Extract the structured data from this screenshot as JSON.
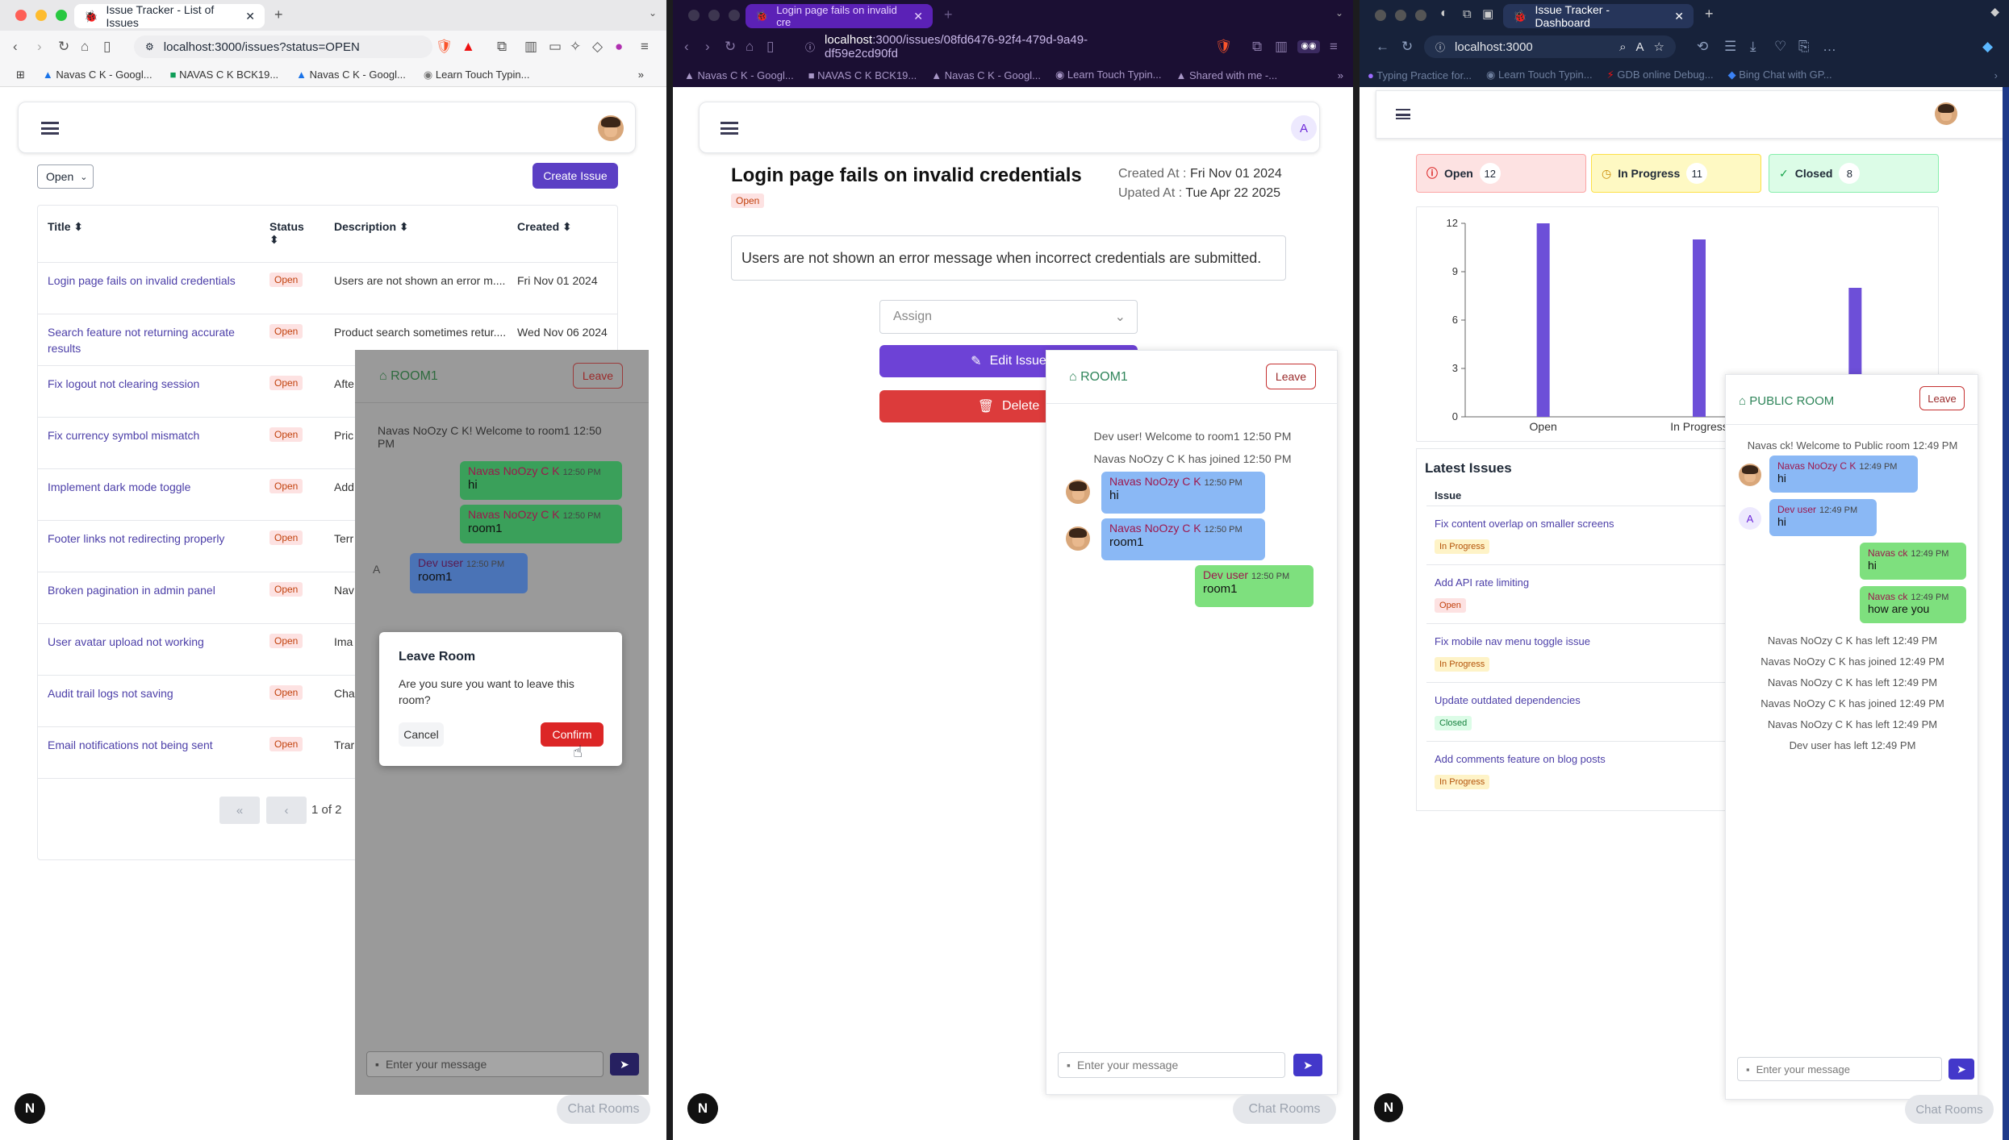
{
  "w1": {
    "tab_title": "Issue Tracker - List of Issues",
    "url": "localhost:3000/issues?status=OPEN",
    "bookmarks": [
      "Navas C K - Googl...",
      "NAVAS C K BCK19...",
      "Navas C K - Googl...",
      "Learn Touch Typin..."
    ],
    "filter": "Open",
    "create_btn": "Create Issue",
    "headers": [
      "Title",
      "Status",
      "Description",
      "Created"
    ],
    "rows": [
      {
        "title": "Login page fails on invalid credentials",
        "status": "Open",
        "desc": "Users are not shown an error m....",
        "created": "Fri Nov 01 2024"
      },
      {
        "title": "Search feature not returning accurate results",
        "status": "Open",
        "desc": "Product search sometimes retur....",
        "created": "Wed Nov 06 2024"
      },
      {
        "title": "Fix logout not clearing session",
        "status": "Open",
        "desc": "Afte",
        "created": ""
      },
      {
        "title": "Fix currency symbol mismatch",
        "status": "Open",
        "desc": "Pric for..",
        "created": ""
      },
      {
        "title": "Implement dark mode toggle",
        "status": "Open",
        "desc": "Add betw",
        "created": ""
      },
      {
        "title": "Footer links not redirecting properly",
        "status": "Open",
        "desc": "Terr t....",
        "created": ""
      },
      {
        "title": "Broken pagination in admin panel",
        "status": "Open",
        "desc": "Nav doe",
        "created": ""
      },
      {
        "title": "User avatar upload not working",
        "status": "Open",
        "desc": "Ima int..",
        "created": ""
      },
      {
        "title": "Audit trail logs not saving",
        "status": "Open",
        "desc": "Cha aren",
        "created": ""
      },
      {
        "title": "Email notifications not being sent",
        "status": "Open",
        "desc": "Trar r....",
        "created": ""
      }
    ],
    "pagination": "1 of 2",
    "chat": {
      "room": "ROOM1",
      "leave": "Leave",
      "welcome": "Navas NoOzy C K! Welcome to room1 12:50 PM",
      "msgs": [
        {
          "who": "Navas NoOzy C K",
          "time": "12:50 PM",
          "text": "hi"
        },
        {
          "who": "Navas NoOzy C K",
          "time": "12:50 PM",
          "text": "room1"
        },
        {
          "who": "Dev user",
          "time": "12:50 PM",
          "text": "room1",
          "avatar": "A"
        }
      ],
      "placeholder": "Enter your message"
    },
    "modal": {
      "title": "Leave Room",
      "body": "Are you sure you want to leave this room?",
      "cancel": "Cancel",
      "confirm": "Confirm"
    },
    "chat_rooms": "Chat Rooms"
  },
  "w2": {
    "tab_title": "Login page fails on invalid cre",
    "url_host": "localhost",
    "url_path": ":3000/issues/08fd6476-92f4-479d-9a49-df59e2cd90fd",
    "bookmarks": [
      "Navas C K - Googl...",
      "NAVAS C K BCK19...",
      "Navas C K - Googl...",
      "Learn Touch Typin...",
      "Shared with me -..."
    ],
    "avatar": "A",
    "issue_title": "Login page fails on invalid credentials",
    "status": "Open",
    "created_label": "Created At :",
    "created": "Fri Nov 01 2024",
    "updated_label": "Upated At :",
    "updated": "Tue Apr 22 2025",
    "description": "Users are not shown an error message when incorrect credentials are submitted.",
    "assign": "Assign",
    "edit": "Edit Issue",
    "delete": "Delete",
    "chat": {
      "room": "ROOM1",
      "leave": "Leave",
      "sys": [
        "Dev user! Welcome to room1 12:50 PM",
        "Navas NoOzy C K has joined 12:50 PM"
      ],
      "msgs": [
        {
          "who": "Navas NoOzy C K",
          "time": "12:50 PM",
          "text": "hi"
        },
        {
          "who": "Navas NoOzy C K",
          "time": "12:50 PM",
          "text": "room1"
        },
        {
          "who": "Dev user",
          "time": "12:50 PM",
          "text": "room1"
        }
      ],
      "placeholder": "Enter your message"
    },
    "chat_rooms": "Chat Rooms"
  },
  "w3": {
    "tab_title": "Issue Tracker - Dashboard",
    "url": "localhost:3000",
    "bookmarks": [
      "Typing Practice for...",
      "Learn Touch Typin...",
      "GDB online Debug...",
      "Bing Chat with GP..."
    ],
    "stats": [
      {
        "label": "Open",
        "count": "12"
      },
      {
        "label": "In Progress",
        "count": "11"
      },
      {
        "label": "Closed",
        "count": "8"
      }
    ],
    "latest_title": "Latest Issues",
    "issue_col": "Issue",
    "latest": [
      {
        "title": "Fix content overlap on smaller screens",
        "status": "In Progress"
      },
      {
        "title": "Add API rate limiting",
        "status": "Open"
      },
      {
        "title": "Fix mobile nav menu toggle issue",
        "status": "In Progress"
      },
      {
        "title": "Update outdated dependencies",
        "status": "Closed"
      },
      {
        "title": "Add comments feature on blog posts",
        "status": "In Progress"
      }
    ],
    "chat": {
      "room": "PUBLIC ROOM",
      "leave": "Leave",
      "welcome": "Navas ck! Welcome to Public room 12:49 PM",
      "msgs": [
        {
          "who": "Navas NoOzy C K",
          "time": "12:49 PM",
          "text": "hi"
        },
        {
          "who": "Dev user",
          "time": "12:49 PM",
          "text": "hi",
          "avatar": "A"
        },
        {
          "who": "Navas ck",
          "time": "12:49 PM",
          "text": "hi"
        },
        {
          "who": "Navas ck",
          "time": "12:49 PM",
          "text": "how are you"
        }
      ],
      "sys": [
        "Navas NoOzy C K has left 12:49 PM",
        "Navas NoOzy C K has joined 12:49 PM",
        "Navas NoOzy C K has left 12:49 PM",
        "Navas NoOzy C K has joined 12:49 PM",
        "Navas NoOzy C K has left 12:49 PM",
        "Dev user has left 12:49 PM"
      ],
      "placeholder": "Enter your message"
    },
    "chat_rooms": "Chat Rooms"
  },
  "chart_data": {
    "type": "bar",
    "categories": [
      "Open",
      "In Progress",
      "Closed"
    ],
    "values": [
      12,
      11,
      8
    ],
    "ylim": [
      0,
      12
    ],
    "yticks": [
      0,
      3,
      6,
      9,
      12
    ],
    "color": "#6d4fd8"
  }
}
